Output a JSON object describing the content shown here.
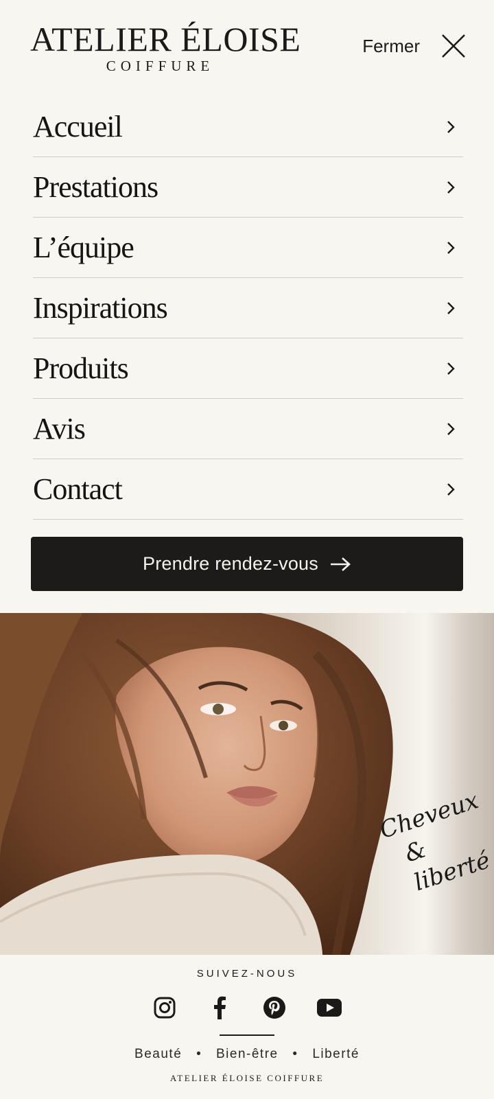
{
  "header": {
    "logo_title": "ATELIER ÉLOISE",
    "logo_subtitle": "COIFFURE",
    "close_label": "Fermer",
    "close_icon": "close-icon"
  },
  "nav": {
    "items": [
      {
        "label": "Accueil"
      },
      {
        "label": "Prestations"
      },
      {
        "label": "L’équipe"
      },
      {
        "label": "Inspirations"
      },
      {
        "label": "Produits"
      },
      {
        "label": "Avis"
      },
      {
        "label": "Contact"
      }
    ],
    "chevron_icon": "chevron-right-icon"
  },
  "cta": {
    "label": "Prendre rendez-vous",
    "icon": "arrow-right-icon"
  },
  "hero": {
    "tagline_line1": "Cheveux",
    "tagline_line2": "& liberté"
  },
  "footer": {
    "follow_label": "SUIVEZ-NOUS",
    "socials": [
      "instagram-icon",
      "facebook-icon",
      "pinterest-icon",
      "youtube-icon"
    ],
    "values": [
      "Beauté",
      "Bien-être",
      "Liberté"
    ],
    "separator": "•",
    "brand": "ATELIER ÉLOISE COIFFURE"
  },
  "colors": {
    "background": "#f8f6f1",
    "text": "#1b1a18",
    "cta_background": "#1c1b19",
    "divider": "#cfccc6"
  }
}
